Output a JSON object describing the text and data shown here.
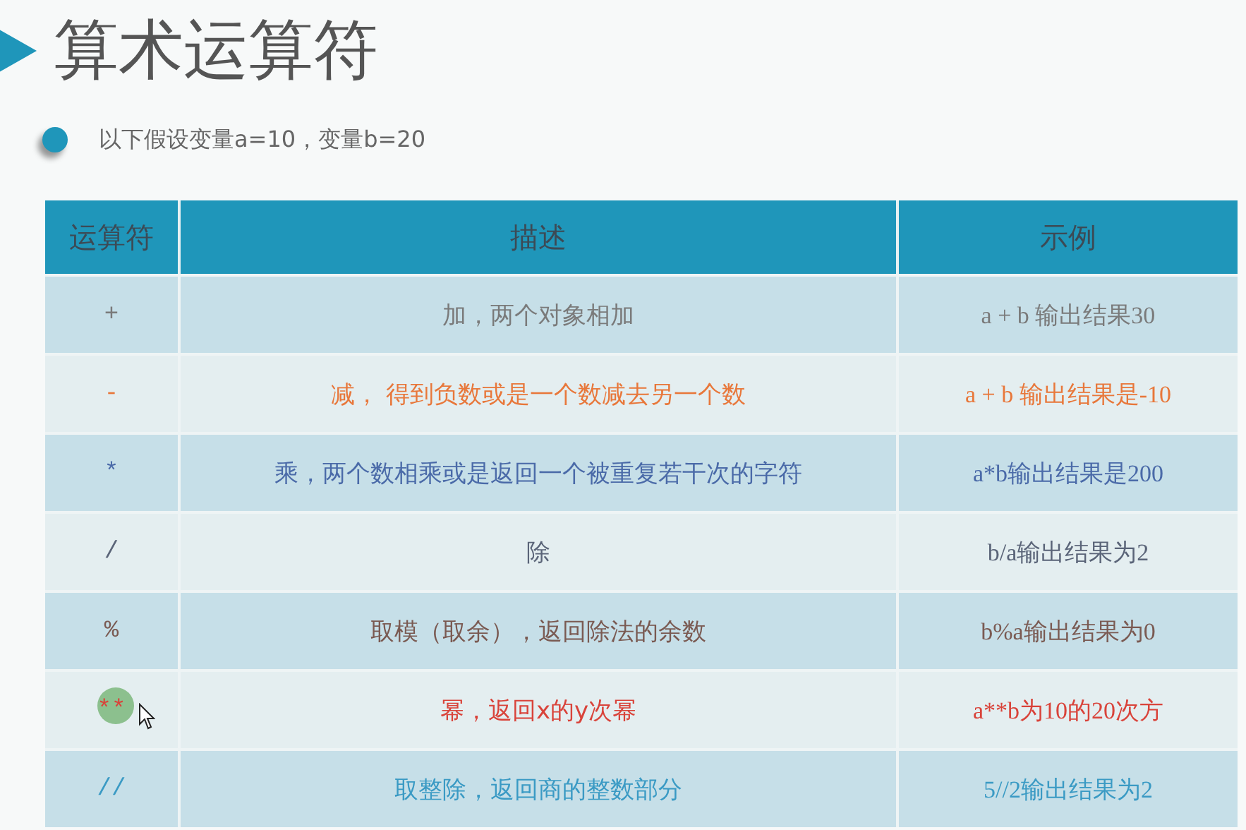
{
  "slide": {
    "title": "算术运算符",
    "bullet": "以下假设变量a=10，变量b=20"
  },
  "table": {
    "columns": [
      "运算符",
      "描述",
      "示例"
    ],
    "rows": [
      {
        "operator": "+",
        "description": "加，两个对象相加",
        "example": "a + b 输出结果30",
        "color": "#7a7a7a"
      },
      {
        "operator": "-",
        "description": "减， 得到负数或是一个数减去另一个数",
        "example": "a + b 输出结果是-10",
        "color": "#e8773a"
      },
      {
        "operator": "*",
        "description": "乘，两个数相乘或是返回一个被重复若干次的字符",
        "example": "a*b输出结果是200",
        "color": "#4a6aa8"
      },
      {
        "operator": "/",
        "description": "除",
        "example": "b/a输出结果为2",
        "color": "#5a6478"
      },
      {
        "operator": "%",
        "description": "取模（取余），返回除法的余数",
        "example": "b%a输出结果为0",
        "color": "#7a5a52"
      },
      {
        "operator": "**",
        "description": "幂，返回x的y次幂",
        "example": "a**b为10的20次方",
        "color": "#d9433a"
      },
      {
        "operator": "//",
        "description": "取整除，返回商的整数部分",
        "example": "5//2输出结果为2",
        "color": "#3a9ac4"
      }
    ]
  }
}
